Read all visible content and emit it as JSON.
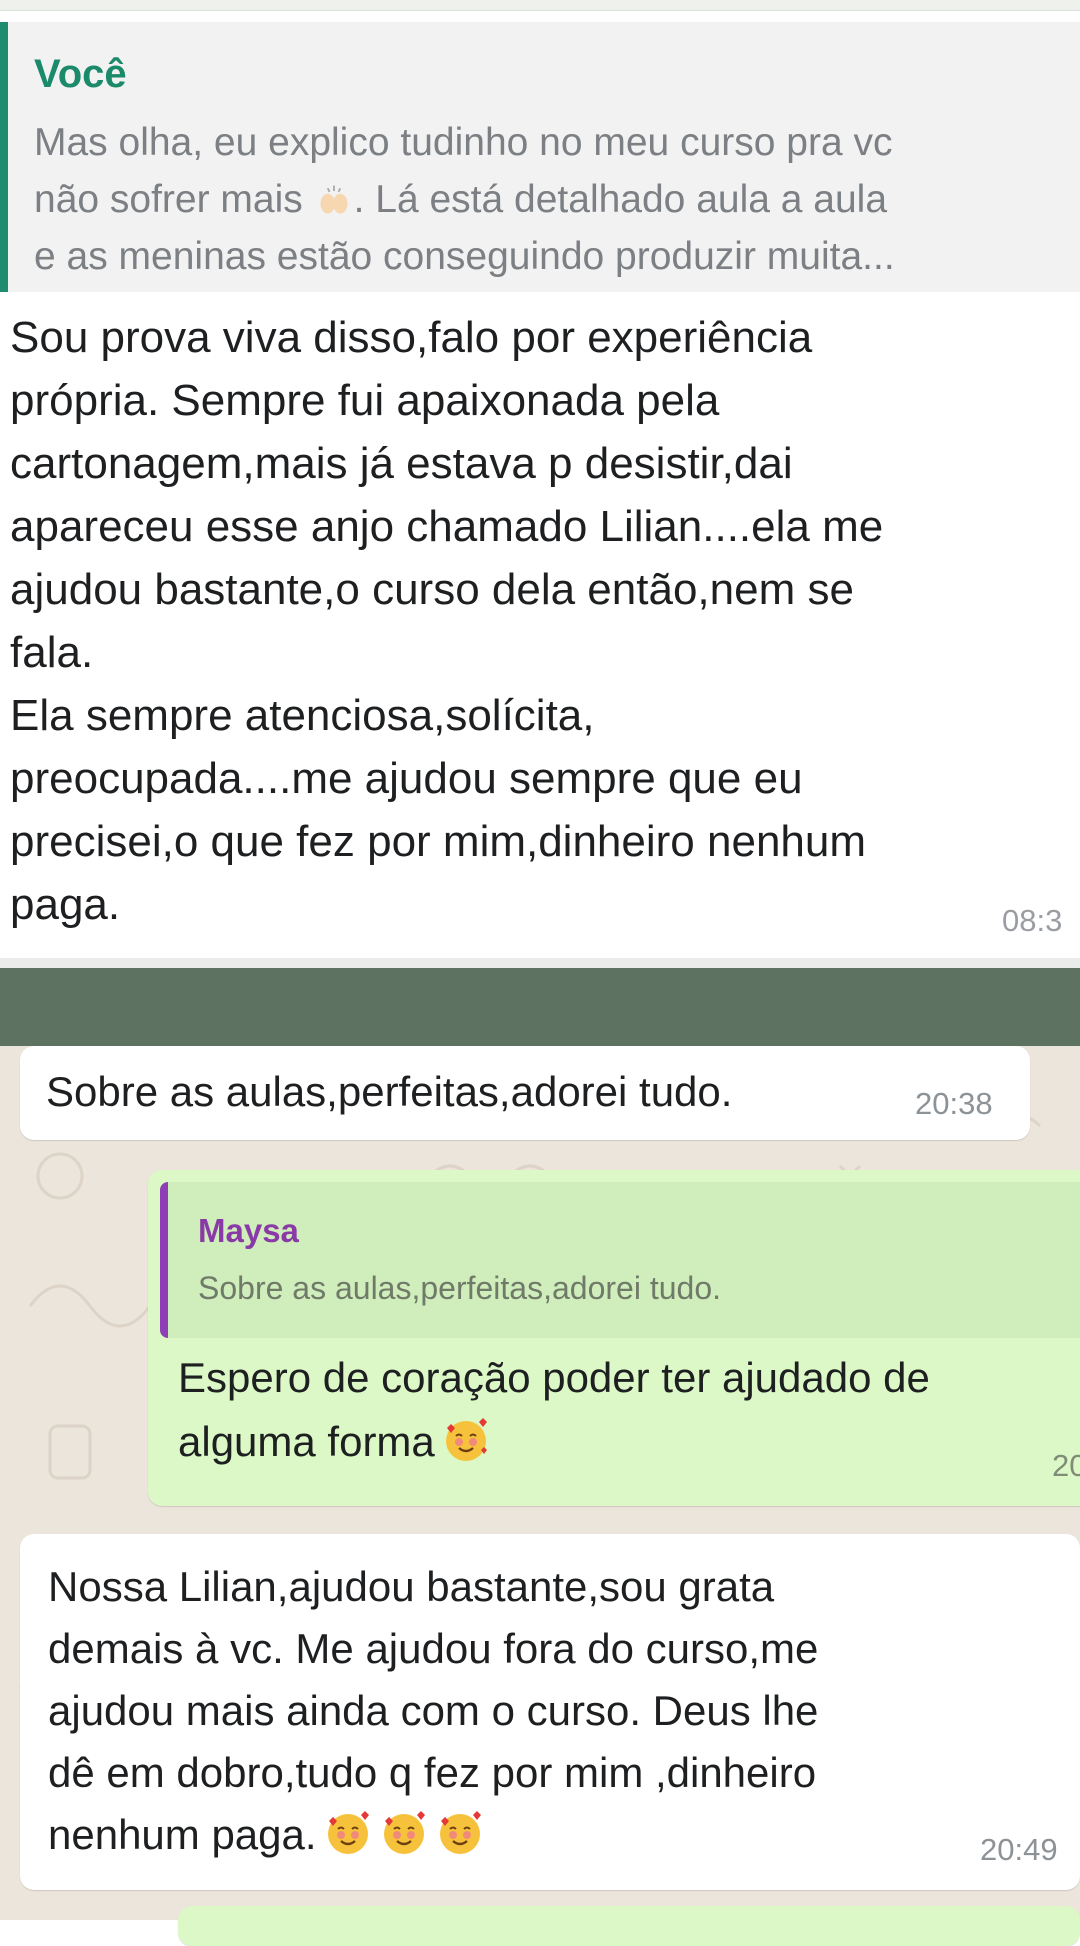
{
  "first_screenshot": {
    "quoted": {
      "author": "Você",
      "line1": "Mas olha, eu explico tudinho no meu curso pra vc",
      "line2_before": "não sofrer mais ",
      "line2_after": ". Lá está detalhado aula a aula",
      "line3": "e as meninas estão conseguindo produzir muita..."
    },
    "message": "Sou prova viva disso,falo por experiência\nprópria. Sempre fui apaixonada pela\ncartonagem,mais já estava p desistir,dai\napareceu esse anjo chamado Lilian....ela me\najudou bastante,o curso dela então,nem se\nfala.\nEla sempre atenciosa,solícita,\npreocupada....me ajudou sempre que eu\nprecisei,o que fez por mim,dinheiro nenhum\npaga.",
    "time": "08:3"
  },
  "chat": {
    "messages": [
      {
        "direction": "incoming",
        "text": "Sobre as aulas,perfeitas,adorei tudo.",
        "time": "20:38"
      },
      {
        "direction": "outgoing",
        "quoted_author": "Maysa",
        "quoted_text": "Sobre as aulas,perfeitas,adorei tudo.",
        "text": "Espero de coração poder ter ajudado de\nalguma forma",
        "time": "20"
      },
      {
        "direction": "incoming",
        "text": "Nossa Lilian,ajudou bastante,sou grata\ndemais à vc. Me ajudou fora do curso,me\najudou mais ainda com o curso. Deus lhe\ndê em dobro,tudo q fez por mim ,dinheiro\nnenhum paga.",
        "time": "20:49"
      }
    ]
  },
  "colors": {
    "incoming_bubble": "#ffffff",
    "outgoing_bubble": "#dcf8c6",
    "wallpaper": "#ece5dc",
    "divider_band": "#5e7261",
    "quote_author_self": "#1b8a6b",
    "quote_author_other": "#8a3aa6"
  },
  "icons": {
    "pray": "raising-hands-emoji",
    "love": "smiling-face-with-hearts-emoji"
  }
}
